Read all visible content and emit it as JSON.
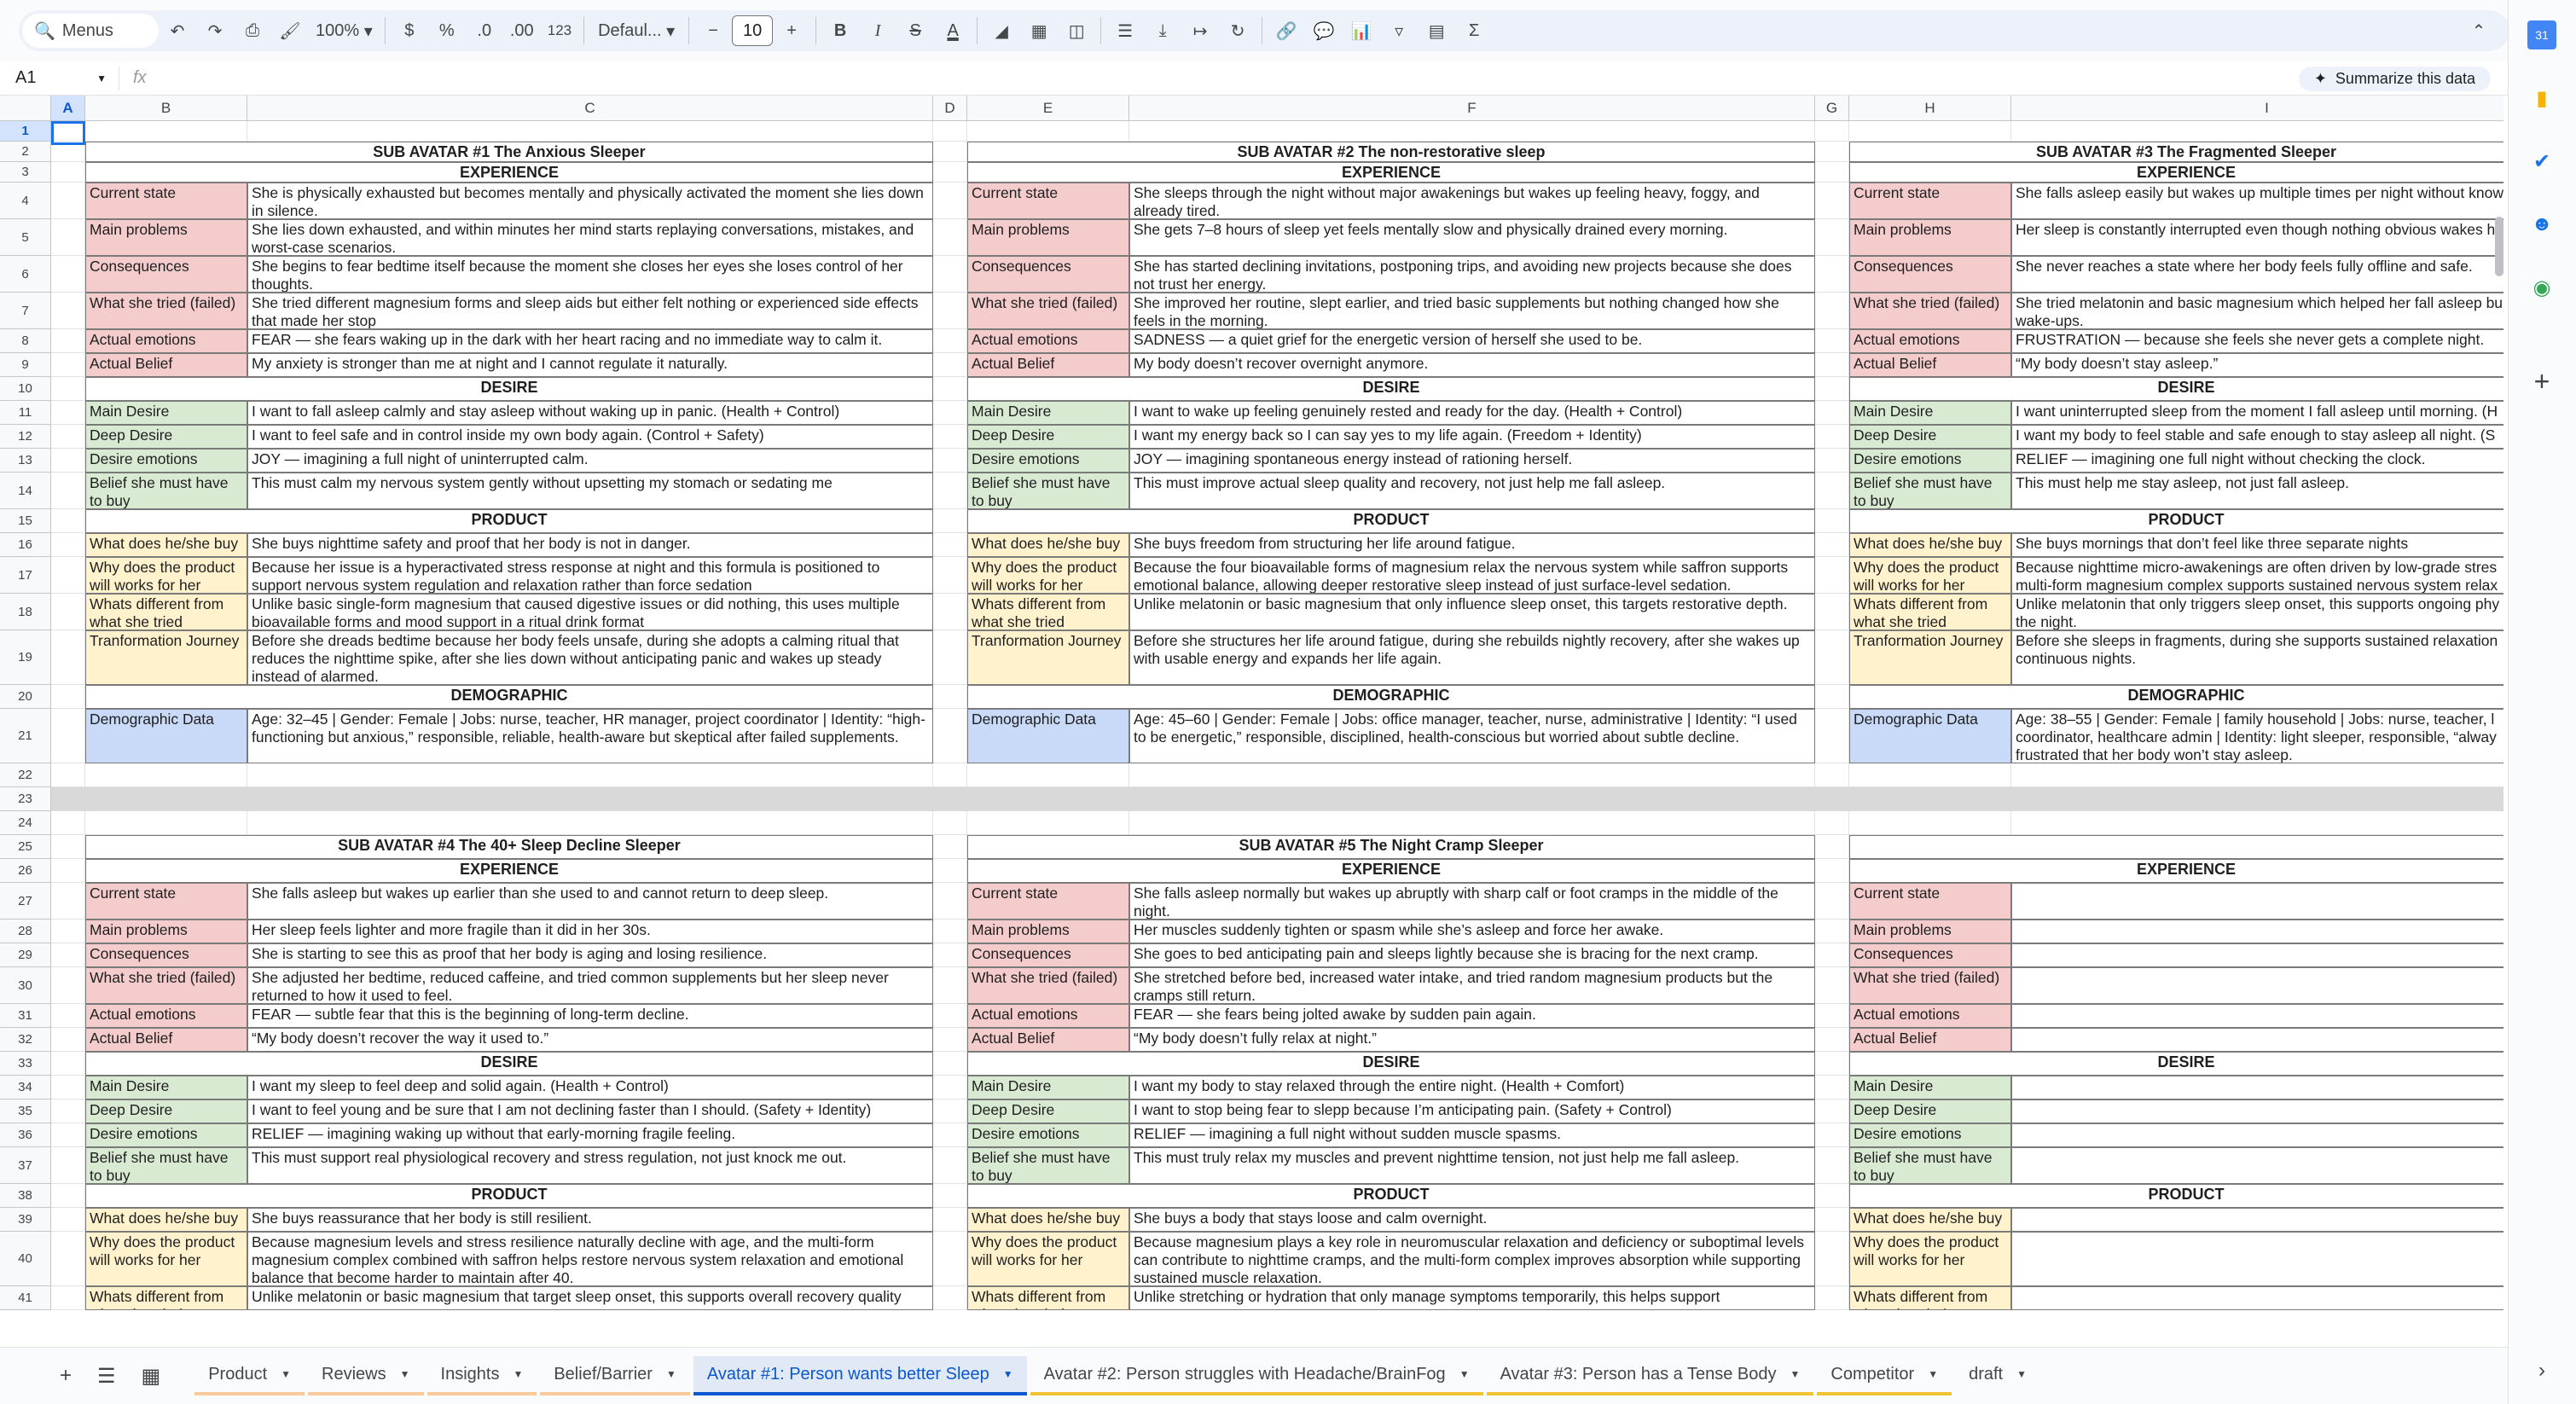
{
  "toolbar": {
    "menus_label": "Menus",
    "zoom": "100%",
    "currency": "$",
    "percent": "%",
    "dec_decrease": ".0",
    "dec_increase": ".00",
    "number_format": "123",
    "font": "Defaul...",
    "font_size": "10",
    "bold": "B",
    "italic": "I",
    "text_color": "A",
    "functions": "Σ"
  },
  "formula_bar": {
    "cell_ref": "A1",
    "fx": "fx",
    "value": "",
    "summarize": "Summarize this data"
  },
  "columns": [
    "A",
    "B",
    "C",
    "D",
    "E",
    "F",
    "G",
    "H",
    "I"
  ],
  "rows": [
    "1",
    "2",
    "3",
    "4",
    "5",
    "6",
    "7",
    "8",
    "9",
    "10",
    "11",
    "12",
    "13",
    "14",
    "15",
    "16",
    "17",
    "18",
    "19",
    "20",
    "21",
    "22",
    "23",
    "24",
    "25",
    "26",
    "27",
    "28",
    "29",
    "30",
    "31",
    "32",
    "33",
    "34",
    "35",
    "36",
    "37",
    "38",
    "39",
    "40",
    "41"
  ],
  "blocks": {
    "a1": {
      "title": "SUB AVATAR #1 The Anxious Sleeper",
      "values": [
        "She is physically exhausted but becomes mentally and physically activated the moment she lies down in silence.",
        "She lies down exhausted, and within minutes her mind starts replaying conversations, mistakes, and worst-case scenarios.",
        "She begins to fear bedtime itself because the moment she closes her eyes she loses control of her thoughts.",
        "She tried different magnesium forms and sleep aids but either felt nothing or experienced side effects that made her stop",
        "FEAR — she fears waking up in the dark with her heart racing and no immediate way to calm it.",
        "My anxiety is stronger than me at night and I cannot regulate it naturally.",
        "I want to fall asleep calmly and stay asleep without waking up in panic. (Health + Control)",
        "I want to feel safe and in control inside my own body again. (Control + Safety)",
        "JOY — imagining a full night of uninterrupted calm.",
        "This must calm my nervous system gently without upsetting my stomach or sedating me",
        "She buys nighttime safety and proof that her body is not in danger.",
        "Because her issue is a hyperactivated stress response at night and this formula is positioned to support nervous system regulation and relaxation rather than force sedation",
        "Unlike basic single-form magnesium that caused digestive issues or did nothing, this uses multiple bioavailable forms and mood support in a ritual drink format",
        "Before she dreads bedtime because her body feels unsafe, during she adopts a calming ritual that reduces the nighttime spike, after she lies down without anticipating panic and wakes up steady instead of alarmed.",
        "Age: 32–45 | Gender: Female | Jobs: nurse, teacher, HR manager, project coordinator | Identity: “high-functioning but anxious,” responsible, reliable, health-aware but skeptical after failed supplements."
      ]
    },
    "a2": {
      "title": "SUB AVATAR #2 The non-restorative sleep",
      "values": [
        "She sleeps through the night without major awakenings but wakes up feeling heavy, foggy, and already tired.",
        "She gets 7–8 hours of sleep yet feels mentally slow and physically drained every morning.",
        "She has started declining invitations, postponing trips, and avoiding new projects because she does not trust her energy.",
        "She improved her routine, slept earlier, and tried basic supplements but nothing changed how she feels in the morning.",
        "SADNESS — a quiet grief for the energetic version of herself she used to be.",
        "My body doesn’t recover overnight anymore.",
        "I want to wake up feeling genuinely rested and ready for the day. (Health + Control)",
        "I want my energy back so I can say yes to my life again. (Freedom + Identity)",
        "JOY — imagining spontaneous energy instead of rationing herself.",
        "This must improve actual sleep quality and recovery, not just help me fall asleep.",
        "She buys freedom from structuring her life around fatigue.",
        "Because the four bioavailable forms of magnesium relax the nervous system while saffron supports emotional balance, allowing deeper restorative sleep instead of just surface-level sedation.",
        "Unlike melatonin or basic magnesium that only influence sleep onset, this targets restorative depth.",
        "Before she structures her life around fatigue, during she rebuilds nightly recovery, after she wakes up with usable energy and expands her life again.",
        "Age: 45–60 | Gender: Female | Jobs: office manager, teacher, nurse, administrative | Identity: “I used to be energetic,” responsible, disciplined, health-conscious but worried about subtle decline."
      ]
    },
    "a3": {
      "title": "SUB AVATAR #3 The Fragmented Sleeper",
      "values": [
        "She falls asleep easily but wakes up multiple times per night without know",
        "Her sleep is constantly interrupted even though nothing obvious wakes he",
        "She never reaches a state where her body feels fully offline and safe.",
        "She tried melatonin and basic magnesium which helped her fall asleep bu wake-ups.",
        "FRUSTRATION — because she feels she never gets a complete night.",
        "“My body doesn’t stay asleep.”",
        "I want uninterrupted sleep from the moment I fall asleep until morning. (H",
        "I want my body to feel stable and safe enough to stay asleep all night. (S",
        "RELIEF — imagining one full night without checking the clock.",
        "This must help me stay asleep, not just fall asleep.",
        "She buys mornings that don’t feel like three separate nights",
        "Because nighttime micro-awakenings are often driven by low-grade stres multi-form magnesium complex supports sustained nervous system relax emotional stability, helping maintain sleep instead of only initiating it.",
        "Unlike melatonin that only triggers sleep onset, this supports ongoing phy the night.",
        "Before she sleeps in fragments, during she supports sustained relaxation continuous nights.",
        "Age: 38–55 | Gender: Female | family household | Jobs: nurse, teacher, l coordinator, healthcare admin | Identity: light sleeper, responsible, “alway frustrated that her body won’t stay asleep."
      ]
    },
    "a4": {
      "title": "SUB AVATAR #4 The 40+ Sleep Decline Sleeper",
      "values": [
        "She falls asleep but wakes up earlier than she used to and cannot return to deep sleep.",
        "Her sleep feels lighter and more fragile than it did in her 30s.",
        "She is starting to see this as proof that her body is aging and losing resilience.",
        "She adjusted her bedtime, reduced caffeine, and tried common supplements but her sleep never returned to how it used to feel.",
        "FEAR — subtle fear that this is the beginning of long-term decline.",
        "“My body doesn’t recover the way it used to.”",
        "I want my sleep to feel deep and solid again. (Health + Control)",
        "I want to feel young and be sure that I am not declining faster than I should. (Safety + Identity)",
        "RELIEF — imagining waking up without that early-morning fragile feeling.",
        "This must support real physiological recovery and stress regulation, not just knock me out.",
        "She buys reassurance that her body is still resilient.",
        "Because magnesium levels and stress resilience naturally decline with age, and the multi-form magnesium complex combined with saffron helps restore nervous system relaxation and emotional balance that become harder to maintain after 40.",
        "Unlike melatonin or basic magnesium that target sleep onset, this supports overall recovery quality"
      ]
    },
    "a5": {
      "title": "SUB AVATAR #5 The Night Cramp Sleeper",
      "values": [
        "She falls asleep normally but wakes up abruptly with sharp calf or foot cramps in the middle of the night.",
        "Her muscles suddenly tighten or spasm while she’s asleep and force her awake.",
        "She goes to bed anticipating pain and sleeps lightly because she is bracing for the next cramp.",
        "She stretched before bed, increased water intake, and tried random magnesium products but the cramps still return.",
        "FEAR — she fears being jolted awake by sudden pain again.",
        "“My body doesn’t fully relax at night.”",
        "I want my body to stay relaxed through the entire night. (Health + Comfort)",
        "I want to stop being fear to slepp because I’m anticipating pain. (Safety + Control)",
        "RELIEF — imagining a full night without sudden muscle spasms.",
        "This must truly relax my muscles and prevent nighttime tension, not just help me fall asleep.",
        "She buys a body that stays loose and calm overnight.",
        "Because magnesium plays a key role in neuromuscular relaxation and deficiency or suboptimal levels can contribute to nighttime cramps, and the multi-form complex improves absorption while supporting sustained muscle relaxation.",
        "Unlike stretching or hydration that only manage symptoms temporarily, this helps support"
      ]
    },
    "a6": {
      "title": "",
      "values": []
    }
  },
  "labels": {
    "experience": "EXPERIENCE",
    "desire": "DESIRE",
    "product": "PRODUCT",
    "demographic": "DEMOGRAPHIC",
    "current_state": "Current state",
    "main_problems": "Main problems",
    "consequences": "Consequences",
    "what_tried": "What she tried (failed)",
    "actual_emotions": "Actual emotions",
    "actual_belief": "Actual Belief",
    "main_desire": "Main Desire",
    "deep_desire": "Deep Desire",
    "desire_emotions": "Desire emotions",
    "belief_buy": "Belief she must have to buy",
    "what_buy": "What does he/she buy",
    "why_works": "Why does the product will works for her",
    "whats_diff": "Whats different from what she tried",
    "transformation": "Tranformation Journey",
    "demo_data": "Demographic Data"
  },
  "tabs": [
    {
      "label": "Product",
      "color": "#f9cb9c"
    },
    {
      "label": "Reviews",
      "color": "#f9cb9c"
    },
    {
      "label": "Insights",
      "color": "#f9cb9c"
    },
    {
      "label": "Belief/Barrier",
      "color": "#f9cb9c"
    },
    {
      "label": "Avatar #1: Person wants better Sleep",
      "color": "#0b57d0",
      "active": true
    },
    {
      "label": "Avatar #2: Person struggles with Headache/BrainFog",
      "color": "#f1c232"
    },
    {
      "label": "Avatar #3: Person has a Tense Body",
      "color": "#f1c232"
    },
    {
      "label": "Competitor",
      "color": "#f1c232"
    },
    {
      "label": "draft",
      "color": ""
    }
  ]
}
